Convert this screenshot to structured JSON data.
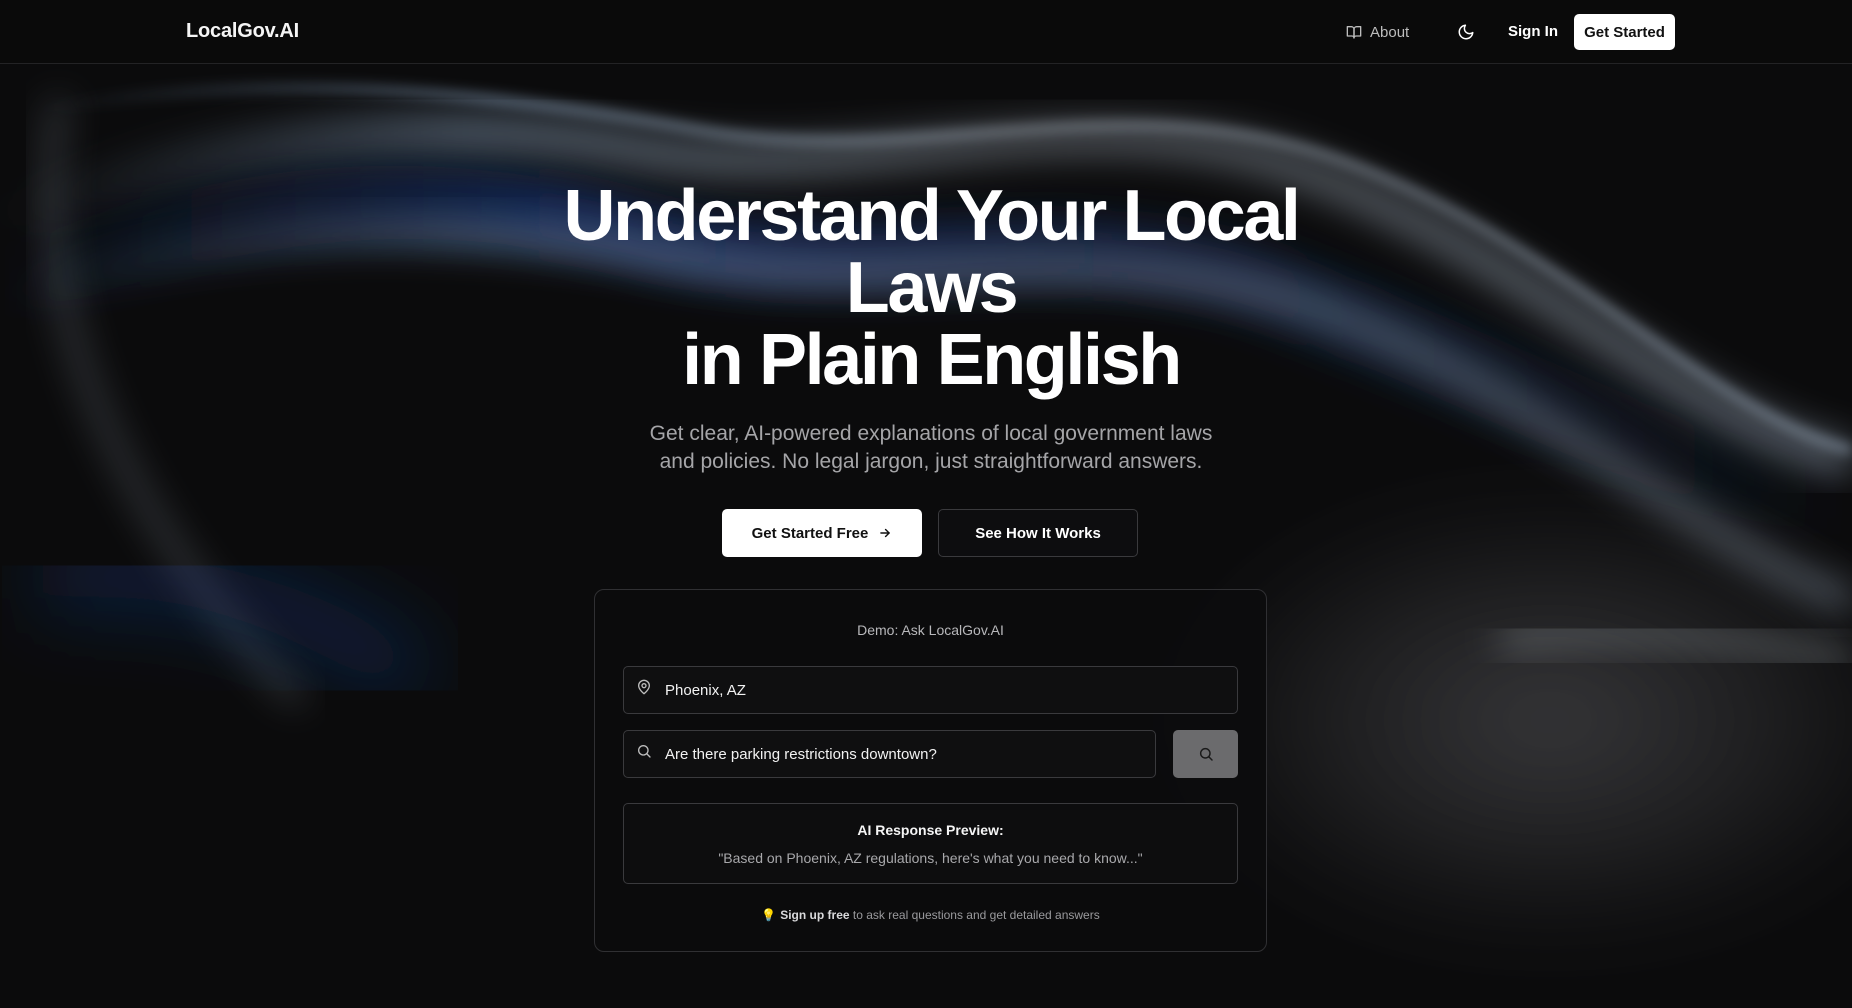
{
  "header": {
    "logo": "LocalGov.AI",
    "about_label": "About",
    "sign_in_label": "Sign In",
    "get_started_label": "Get Started"
  },
  "hero": {
    "title_line1": "Understand Your Local",
    "title_line2": "Laws",
    "title_line3": "in Plain English",
    "subtitle_line1": "Get clear, AI-powered explanations of local government laws",
    "subtitle_line2": "and policies. No legal jargon, just straightforward answers.",
    "primary_cta": "Get Started Free",
    "secondary_cta": "See How It Works"
  },
  "demo": {
    "label": "Demo: Ask LocalGov.AI",
    "location_value": "Phoenix, AZ",
    "question_value": "Are there parking restrictions downtown?",
    "preview_title": "AI Response Preview:",
    "preview_text": "\"Based on Phoenix, AZ regulations, here's what you need to know...\"",
    "footer_signup": "Sign up free",
    "footer_rest": " to ask real questions and get detailed answers"
  },
  "icons": {
    "about": "book-open-icon",
    "theme": "moon-icon",
    "cta_arrow": "arrow-right-icon",
    "location": "map-pin-icon",
    "question": "search-icon",
    "search_button": "search-icon",
    "tip": "lightbulb-icon"
  },
  "colors": {
    "background": "#0b0b0c",
    "header": "#0a0a0a",
    "primary_button": "#ffffff",
    "search_button": "#6b6b6d",
    "muted_text": "#a5a5a8",
    "bulb": "#f4c542"
  }
}
